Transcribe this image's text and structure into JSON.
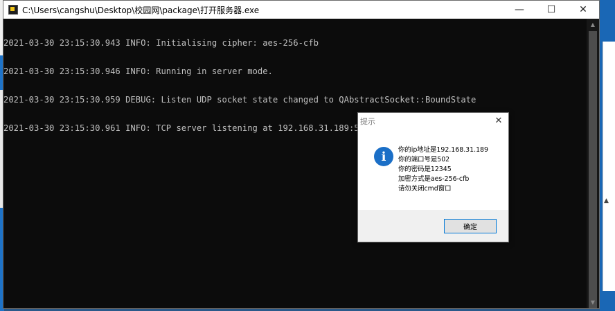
{
  "window": {
    "title": "C:\\Users\\cangshu\\Desktop\\校园网\\package\\打开服务器.exe",
    "minimize_glyph": "—",
    "maximize_glyph": "☐",
    "close_glyph": "✕",
    "icon": "console-app-icon"
  },
  "console": {
    "lines": [
      "2021-03-30 23:15:30.943 INFO: Initialising cipher: aes-256-cfb",
      "2021-03-30 23:15:30.946 INFO: Running in server mode.",
      "2021-03-30 23:15:30.959 DEBUG: Listen UDP socket state changed to QAbstractSocket::BoundState",
      "2021-03-30 23:15:30.961 INFO: TCP server listening at 192.168.31.189:502"
    ],
    "text_color": "#c0c0c0",
    "background": "#0c0c0c"
  },
  "dialog": {
    "title": "提示",
    "close_glyph": "✕",
    "icon": "info-icon",
    "icon_glyph": "i",
    "messages": [
      "你的ip地址是192.168.31.189",
      "你的端口号是502",
      "你的密码是12345",
      "加密方式是aes-256-cfb",
      "请勿关闭cmd窗口"
    ],
    "ok_label": "确定",
    "accent": "#0078d7"
  }
}
